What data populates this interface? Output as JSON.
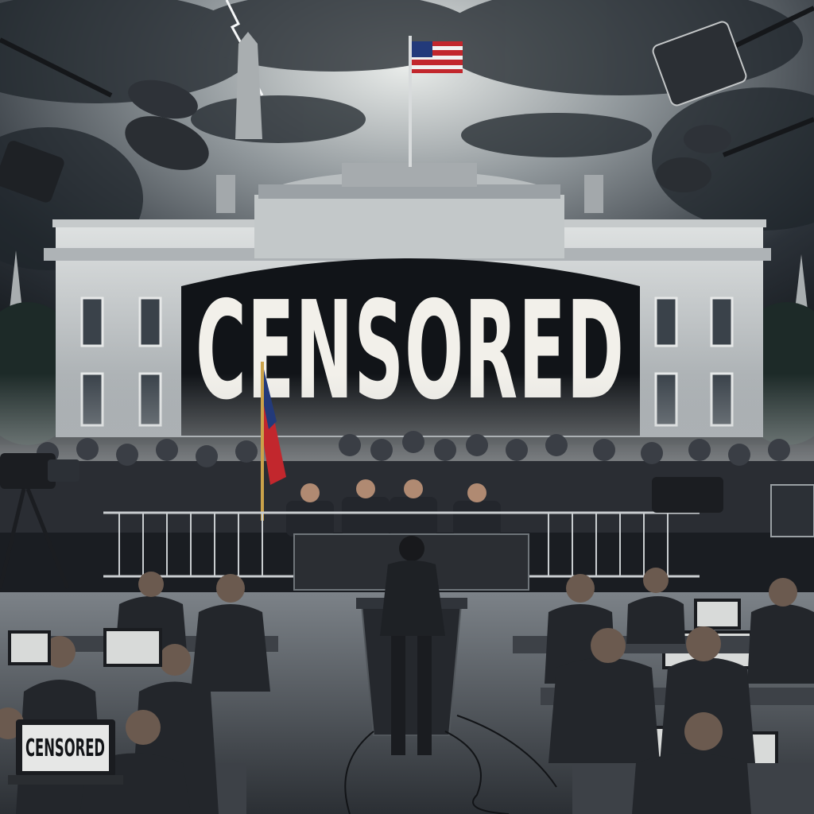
{
  "scene": {
    "banner_text": "CENSORED",
    "laptop_screen_text": "CENSORED"
  },
  "colors": {
    "sky_dark": "#1e242b",
    "sky_light": "#c9ccc9",
    "building": "#d3d6d6",
    "building_shadow": "#8d9296",
    "banner": "#111418",
    "banner_text": "#f2f0ea",
    "flag_red": "#c2272d",
    "flag_blue": "#233a7a",
    "crowd": "#2a2d33",
    "floor": "#4a4f55"
  }
}
